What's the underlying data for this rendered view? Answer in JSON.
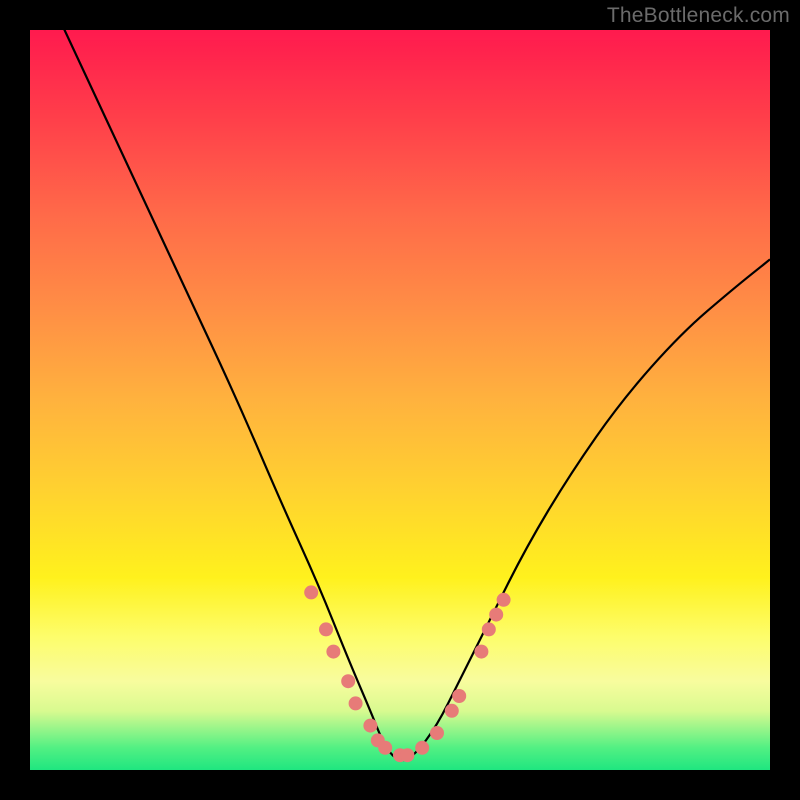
{
  "watermark": "TheBottleneck.com",
  "chart_data": {
    "type": "line",
    "title": "",
    "xlabel": "",
    "ylabel": "",
    "xlim": [
      0,
      100
    ],
    "ylim": [
      0,
      100
    ],
    "series": [
      {
        "name": "bottleneck-curve",
        "x": [
          0,
          7,
          14,
          21,
          28,
          34,
          39,
          43,
          46,
          48,
          50,
          52,
          55,
          58,
          62,
          67,
          73,
          80,
          88,
          95,
          100
        ],
        "y": [
          110,
          95,
          80,
          65,
          50,
          36,
          25,
          15,
          8,
          3,
          1,
          2,
          6,
          12,
          20,
          30,
          40,
          50,
          59,
          65,
          69
        ]
      }
    ],
    "markers": {
      "name": "highlight-dots",
      "color": "#e77b78",
      "points": [
        {
          "x": 38,
          "y": 24
        },
        {
          "x": 40,
          "y": 19
        },
        {
          "x": 41,
          "y": 16
        },
        {
          "x": 43,
          "y": 12
        },
        {
          "x": 44,
          "y": 9
        },
        {
          "x": 46,
          "y": 6
        },
        {
          "x": 47,
          "y": 4
        },
        {
          "x": 48,
          "y": 3
        },
        {
          "x": 50,
          "y": 2
        },
        {
          "x": 51,
          "y": 2
        },
        {
          "x": 53,
          "y": 3
        },
        {
          "x": 55,
          "y": 5
        },
        {
          "x": 57,
          "y": 8
        },
        {
          "x": 58,
          "y": 10
        },
        {
          "x": 61,
          "y": 16
        },
        {
          "x": 62,
          "y": 19
        },
        {
          "x": 63,
          "y": 21
        },
        {
          "x": 64,
          "y": 23
        }
      ]
    },
    "background_gradient": {
      "top": "#ff1a4e",
      "mid": "#ffd130",
      "bottom": "#1fe680"
    }
  }
}
